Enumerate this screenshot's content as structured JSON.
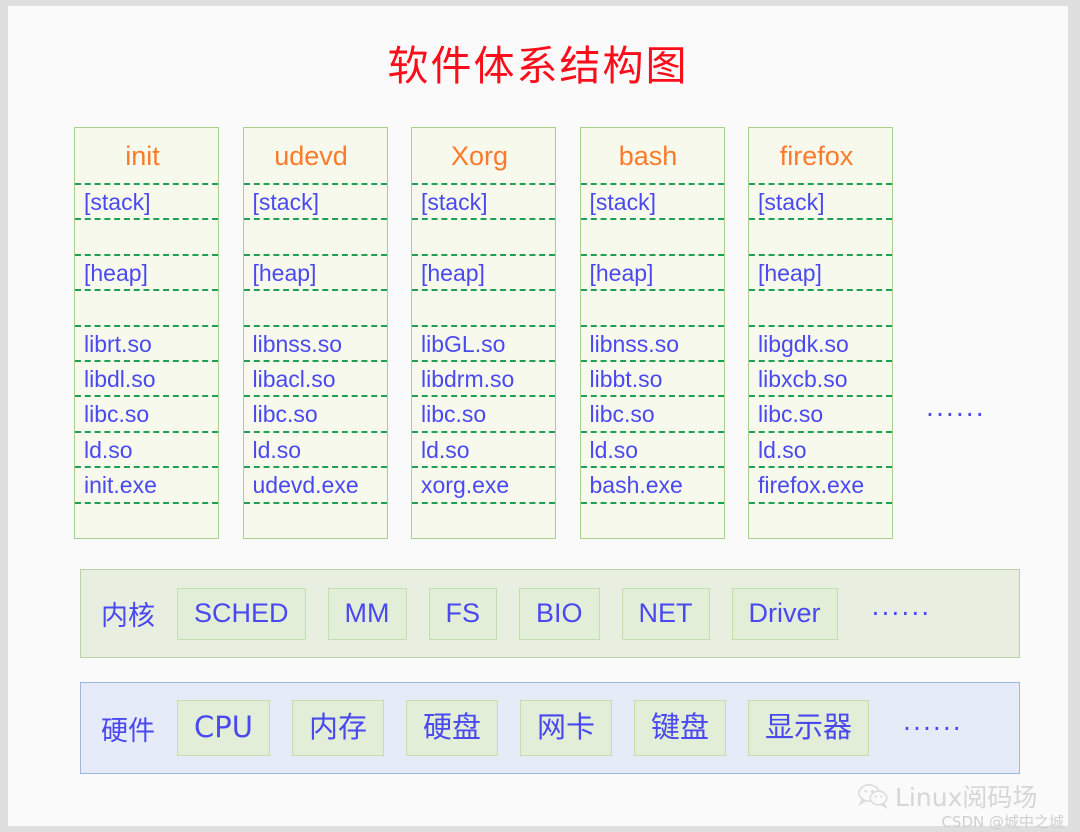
{
  "title": "软件体系结构图",
  "colors": {
    "title": "#fc0d1b",
    "process_header": "#fb7a2b",
    "text_blue": "#4a49f0",
    "process_fill": "#f7f9ec",
    "process_border": "#a9d18e",
    "dashed_divider": "#1fa055",
    "kernel_fill": "#e8efe1",
    "kernel_border": "#b9d3a5",
    "kernel_box_fill": "#e3eed9",
    "hardware_fill": "#e6ecf7",
    "hardware_border": "#9cb9dd",
    "page_bg": "#fafafa"
  },
  "processes": {
    "ellipsis": "······",
    "columns": [
      {
        "name": "init",
        "rows": [
          "[stack]",
          "",
          "[heap]",
          "",
          "librt.so",
          "libdl.so",
          "libc.so",
          "ld.so",
          "init.exe",
          ""
        ]
      },
      {
        "name": "udevd",
        "rows": [
          "[stack]",
          "",
          "[heap]",
          "",
          "libnss.so",
          "libacl.so",
          "libc.so",
          "ld.so",
          "udevd.exe",
          ""
        ]
      },
      {
        "name": "Xorg",
        "rows": [
          "[stack]",
          "",
          "[heap]",
          "",
          "libGL.so",
          "libdrm.so",
          "libc.so",
          "ld.so",
          "xorg.exe",
          ""
        ]
      },
      {
        "name": "bash",
        "rows": [
          "[stack]",
          "",
          "[heap]",
          "",
          "libnss.so",
          "libbt.so",
          "libc.so",
          "ld.so",
          "bash.exe",
          ""
        ]
      },
      {
        "name": "firefox",
        "rows": [
          "[stack]",
          "",
          "[heap]",
          "",
          "libgdk.so",
          "libxcb.so",
          "libc.so",
          "ld.so",
          "firefox.exe",
          ""
        ]
      }
    ]
  },
  "kernel": {
    "label": "内核",
    "boxes": [
      "SCHED",
      "MM",
      "FS",
      "BIO",
      "NET",
      "Driver"
    ],
    "ellipsis": "······"
  },
  "hardware": {
    "label": "硬件",
    "boxes": [
      "CPU",
      "内存",
      "硬盘",
      "网卡",
      "键盘",
      "显示器"
    ],
    "ellipsis": "······"
  },
  "watermark": {
    "brand": "Linux阅码场",
    "credit": "CSDN @城中之城",
    "icon": "wechat-icon"
  }
}
